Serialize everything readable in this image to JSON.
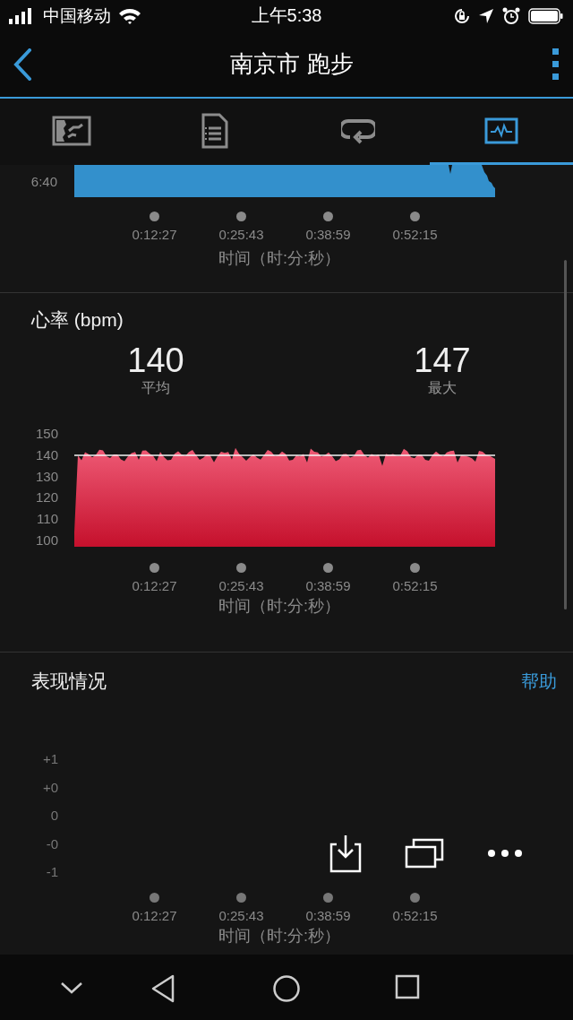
{
  "status_bar": {
    "carrier": "中国移动",
    "time": "上午5:38"
  },
  "header": {
    "title": "南京市 跑步"
  },
  "tabs": [
    {
      "kind": "map",
      "selected": false
    },
    {
      "kind": "details",
      "selected": false
    },
    {
      "kind": "laps",
      "selected": false
    },
    {
      "kind": "chart",
      "selected": true
    }
  ],
  "pace_section": {
    "tick": "6:40",
    "time_labels": [
      "0:12:27",
      "0:25:43",
      "0:38:59",
      "0:52:15"
    ],
    "axis_title": "时间（时:分:秒）"
  },
  "heart_rate": {
    "title": "心率 (bpm)",
    "stats": [
      {
        "value": "140",
        "label": "平均"
      },
      {
        "value": "147",
        "label": "最大"
      }
    ],
    "y_labels": [
      "150",
      "140",
      "130",
      "120",
      "110",
      "100"
    ],
    "time_labels": [
      "0:12:27",
      "0:25:43",
      "0:38:59",
      "0:52:15"
    ],
    "axis_title": "时间（时:分:秒）"
  },
  "performance": {
    "title": "表现情况",
    "help_link": "帮助",
    "y_labels": [
      "+1",
      "+0",
      "0",
      "-0",
      "-1"
    ],
    "time_labels": [
      "0:12:27",
      "0:25:43",
      "0:38:59",
      "0:52:15"
    ],
    "axis_title": "时间（时:分:秒）"
  },
  "action_buttons": [
    {
      "kind": "download"
    },
    {
      "kind": "windows"
    },
    {
      "kind": "more"
    }
  ],
  "nav_bar": [
    {
      "kind": "collapse"
    },
    {
      "kind": "back"
    },
    {
      "kind": "home"
    },
    {
      "kind": "recents"
    }
  ]
}
